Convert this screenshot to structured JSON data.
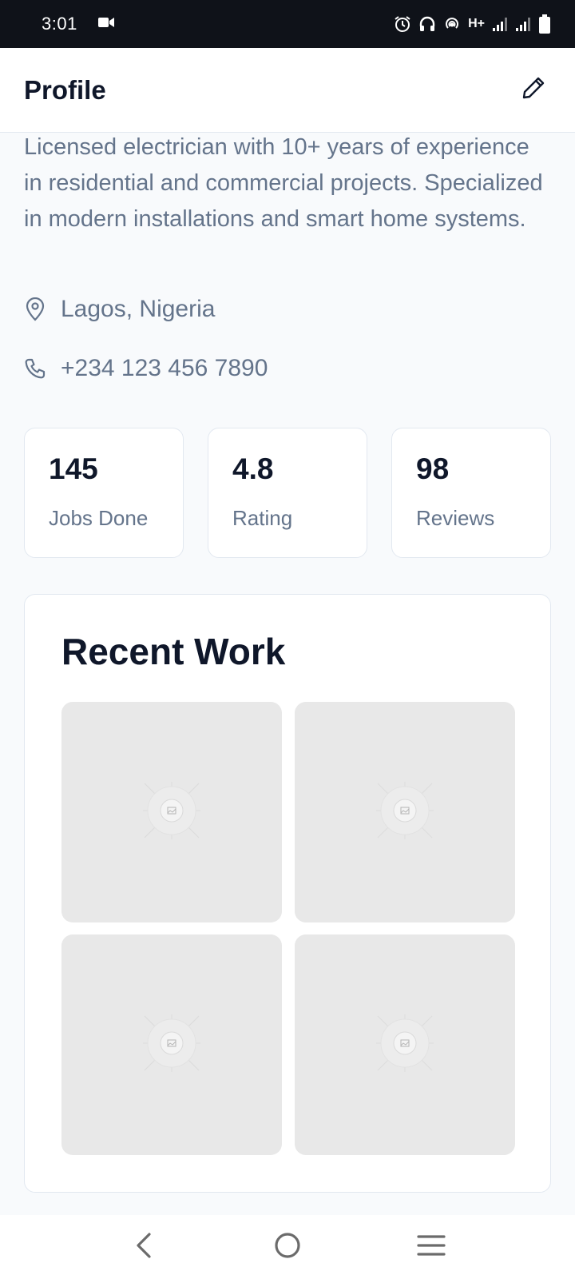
{
  "status_bar": {
    "time": "3:01",
    "network": "H+",
    "icons": [
      "video-camera-icon",
      "alarm-icon",
      "headphones-icon",
      "hotspot-icon",
      "signal-icon",
      "signal-icon",
      "battery-icon"
    ]
  },
  "header": {
    "title": "Profile",
    "edit_icon": "pencil-icon"
  },
  "profile": {
    "bio": "Licensed electrician with 10+ years of experience in residential and commercial projects. Specialized in modern installations and smart home systems.",
    "location": "Lagos, Nigeria",
    "phone": "+234 123 456 7890"
  },
  "stats": [
    {
      "value": "145",
      "label": "Jobs Done"
    },
    {
      "value": "4.8",
      "label": "Rating"
    },
    {
      "value": "98",
      "label": "Reviews"
    }
  ],
  "recent_work": {
    "title": "Recent Work",
    "photos": [
      "image-placeholder",
      "image-placeholder",
      "image-placeholder",
      "image-placeholder"
    ]
  },
  "nav": {
    "back": "back-icon",
    "home": "home-icon",
    "menu": "menu-icon"
  },
  "colors": {
    "background": "#f8fafc",
    "text_primary": "#0f172a",
    "text_secondary": "#64748b",
    "border": "#e2e8f0",
    "placeholder": "#e8e8e8"
  }
}
